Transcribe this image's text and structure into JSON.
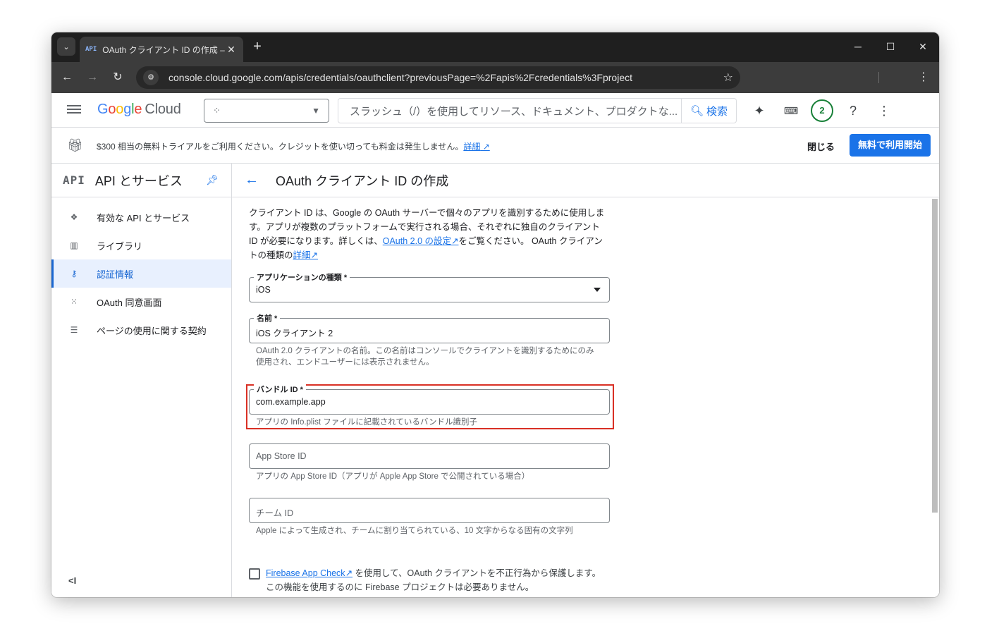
{
  "browser": {
    "tab_title": "OAuth クライアント ID の作成 –",
    "tab_favicon": "API",
    "url": "console.cloud.google.com/apis/credentials/oauthclient?previousPage=%2Fapis%2Fcredentials%3Fproject"
  },
  "header": {
    "logo_google": "Google",
    "logo_cloud": "Cloud",
    "search_placeholder": "スラッシュ（/）を使用してリソース、ドキュメント、プロダクトな...",
    "search_button": "検索",
    "notification_count": "2"
  },
  "banner": {
    "text": "$300 相当の無料トライアルをご利用ください。クレジットを使い切っても料金は発生しません。",
    "link": "詳細",
    "close": "閉じる",
    "cta": "無料で利用開始"
  },
  "sidebar": {
    "logo": "API",
    "title": "API とサービス",
    "items": [
      {
        "label": "有効な API とサービス",
        "icon": "diamond-dots-icon"
      },
      {
        "label": "ライブラリ",
        "icon": "library-icon"
      },
      {
        "label": "認証情報",
        "icon": "key-icon",
        "active": true
      },
      {
        "label": "OAuth 同意画面",
        "icon": "dots-grid-icon"
      },
      {
        "label": "ページの使用に関する契約",
        "icon": "settings-list-icon"
      }
    ],
    "collapse": "<I"
  },
  "main": {
    "title": "OAuth クライアント ID の作成",
    "intro_1": "クライアント ID は、Google の OAuth サーバーで個々のアプリを識別するために使用します。アプリが複数のプラットフォームで実行される場合、それぞれに独自のクライアント ID が必要になります。詳しくは、",
    "intro_link1": "OAuth 2.0 の設定",
    "intro_2": "をご覧ください。 OAuth クライアントの種類の",
    "intro_link2": "詳細",
    "app_type": {
      "label": "アプリケーションの種類 *",
      "value": "iOS"
    },
    "name": {
      "label": "名前 *",
      "value": "iOS クライアント 2",
      "hint": "OAuth 2.0 クライアントの名前。この名前はコンソールでクライアントを識別するためにのみ使用され、エンドユーザーには表示されません。"
    },
    "bundle": {
      "label": "バンドル ID *",
      "value": "com.example.app",
      "hint": "アプリの Info.plist ファイルに記載されているバンドル識別子"
    },
    "appstore": {
      "placeholder": "App Store ID",
      "hint": "アプリの App Store ID（アプリが Apple App Store で公開されている場合）"
    },
    "team": {
      "placeholder": "チーム ID",
      "hint": "Apple によって生成され、チームに割り当てられている、10 文字からなる固有の文字列"
    },
    "firebase": {
      "link": "Firebase App Check",
      "text": " を使用して、OAuth クライアントを不正行為から保護します。この機能を使用するのに Firebase プロジェクトは必要ありません。"
    }
  },
  "colors": {
    "accent": "#1a73e8",
    "highlight": "#d93025",
    "chrome_dark": "#1f1f1f"
  }
}
